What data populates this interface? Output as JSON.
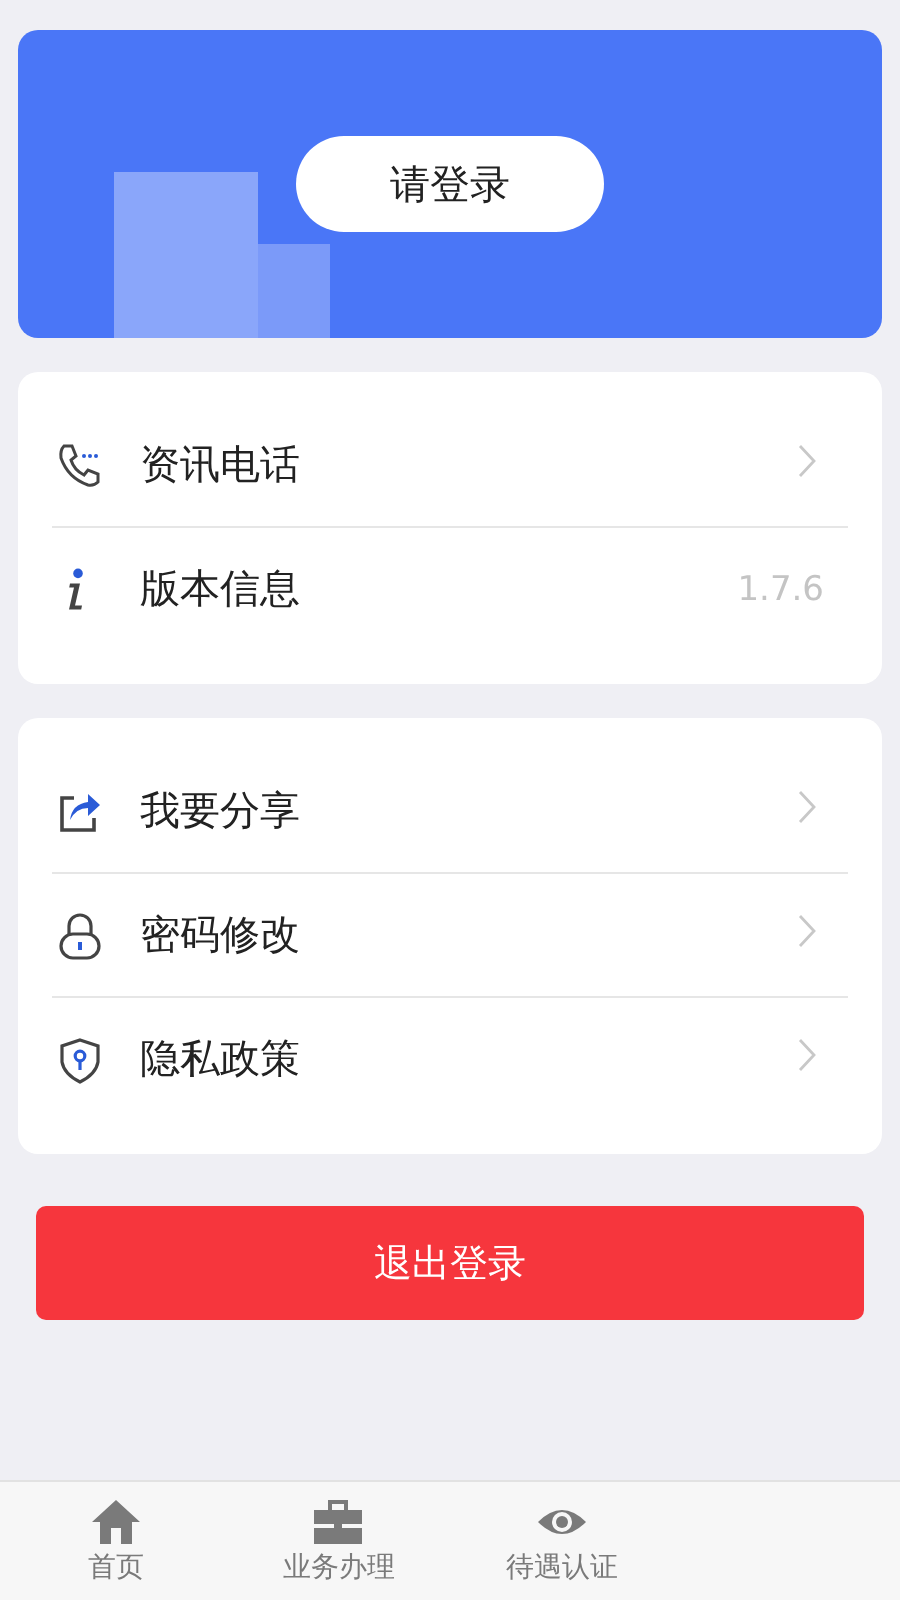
{
  "header": {
    "login_button": "请登录"
  },
  "groups": [
    {
      "items": [
        {
          "label": "资讯电话",
          "kind": "link"
        },
        {
          "label": "版本信息",
          "kind": "value",
          "value": "1.7.6"
        }
      ]
    },
    {
      "items": [
        {
          "label": "我要分享",
          "kind": "link"
        },
        {
          "label": "密码修改",
          "kind": "link"
        },
        {
          "label": "隐私政策",
          "kind": "link"
        }
      ]
    }
  ],
  "logout_button": "退出登录",
  "tab_bar": [
    {
      "label": "首页"
    },
    {
      "label": "业务办理"
    },
    {
      "label": "待遇认证"
    }
  ]
}
